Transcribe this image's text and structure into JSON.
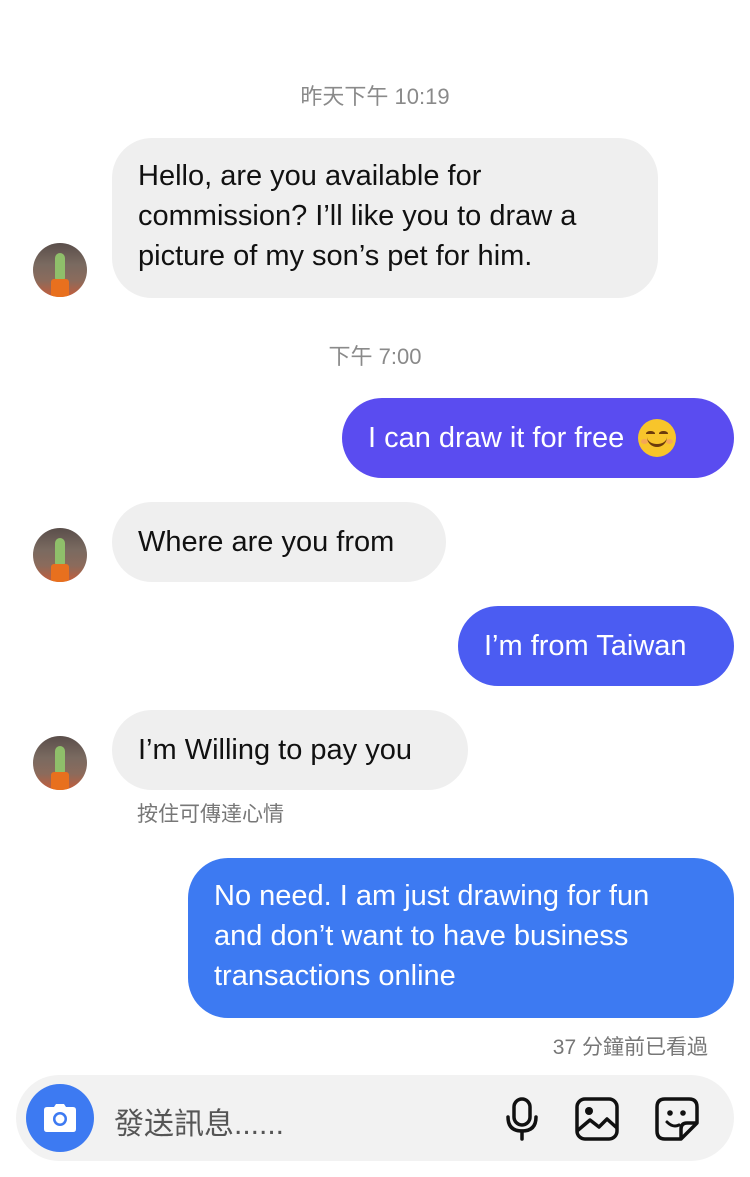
{
  "conversation": {
    "timestamps": [
      "昨天下午 10:19",
      "下午 7:00"
    ],
    "messages": [
      {
        "direction": "incoming",
        "lines": [
          "Hello, are you available for",
          "commission? I’ll like you to draw a",
          "picture of my son’s pet for him."
        ]
      },
      {
        "direction": "outgoing",
        "text": "I can draw it for free",
        "emoji": "smiling-face-emoji"
      },
      {
        "direction": "incoming",
        "text": "Where are you from"
      },
      {
        "direction": "outgoing",
        "text": "I’m from Taiwan"
      },
      {
        "direction": "incoming",
        "text": "I’m Willing to pay you"
      },
      {
        "direction": "outgoing",
        "lines": [
          "No need. I am just drawing for fun",
          "and don’t want to have business",
          "transactions online"
        ]
      }
    ],
    "reaction_hint": "按住可傳達心情",
    "seen_status": "37 分鐘前已看過"
  },
  "composer": {
    "placeholder": "發送訊息......",
    "icons": [
      "camera-icon",
      "microphone-icon",
      "image-icon",
      "sticker-icon"
    ]
  },
  "colors": {
    "incoming_bubble": "#efefef",
    "outgoing_top": "#5a4cf0",
    "outgoing_mid": "#4b5cf2",
    "outgoing_bottom": "#3d7af2"
  }
}
